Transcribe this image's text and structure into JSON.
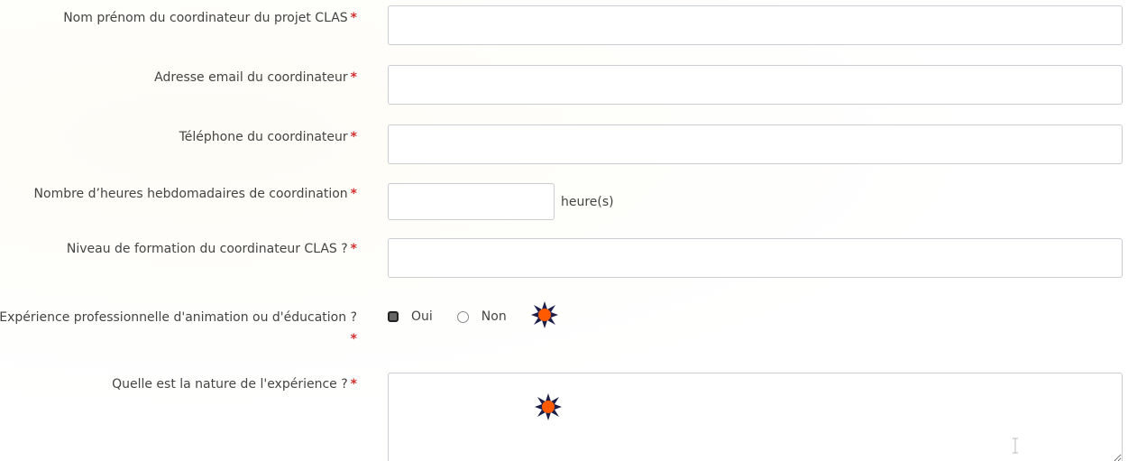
{
  "required_marker": "*",
  "fields": {
    "coordinator_name": {
      "label": "Nom prénom du coordinateur du projet CLAS",
      "value": ""
    },
    "coordinator_email": {
      "label": "Adresse email du coordinateur",
      "value": ""
    },
    "coordinator_phone": {
      "label": "Téléphone du coordinateur",
      "value": ""
    },
    "weekly_hours": {
      "label": "Nombre d’heures hebdomadaires de coordination",
      "value": "",
      "suffix": "heure(s)"
    },
    "training_level": {
      "label": "Niveau de formation du coordinateur CLAS ?",
      "value": ""
    },
    "experience": {
      "label": "Expérience professionnelle d'animation ou d'éducation ?",
      "options": [
        "Oui",
        "Non"
      ],
      "selected": "Oui"
    },
    "experience_nature": {
      "label": "Quelle est la nature de l'expérience ?",
      "value": ""
    }
  },
  "colors": {
    "required": "#d32f2f",
    "marker_fill": "#ff5a00",
    "marker_rays": "#1e1e4a",
    "input_border": "#c9cdd2"
  },
  "icons": [
    "click-marker-icon",
    "text-cursor-icon"
  ]
}
